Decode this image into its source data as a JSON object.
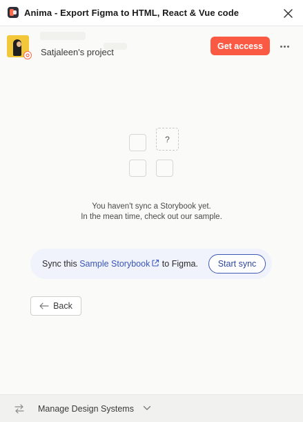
{
  "window": {
    "title": "Anima - Export Figma to HTML, React & Vue code",
    "close_icon": "close-icon",
    "plugin_icon": "anima-logo-icon"
  },
  "header": {
    "project_name": "Satjaleen's project",
    "get_access_label": "Get access",
    "more_icon": "more-horizontal-icon",
    "avatar_icon": "user-avatar",
    "badge_icon": "settings-badge-icon"
  },
  "empty_state": {
    "placeholder_glyph": "?",
    "line1": "You haven't sync a Storybook yet.",
    "line2": "In the mean time, check out our sample."
  },
  "sync_card": {
    "text_before": "Sync this ",
    "link_label": "Sample Storybook",
    "text_after": " to Figma.",
    "link_icon": "external-link-icon",
    "button_label": "Start sync"
  },
  "navigation": {
    "back_label": "Back",
    "back_icon": "arrow-left-icon"
  },
  "footer": {
    "label": "Manage Design Systems",
    "left_icon": "swap-arrows-icon",
    "chevron_icon": "chevron-down-icon"
  },
  "colors": {
    "accent": "#fa5a44",
    "link": "#3a55b8",
    "card_bg": "#f0f3fb",
    "page_bg": "#fafaf8"
  }
}
